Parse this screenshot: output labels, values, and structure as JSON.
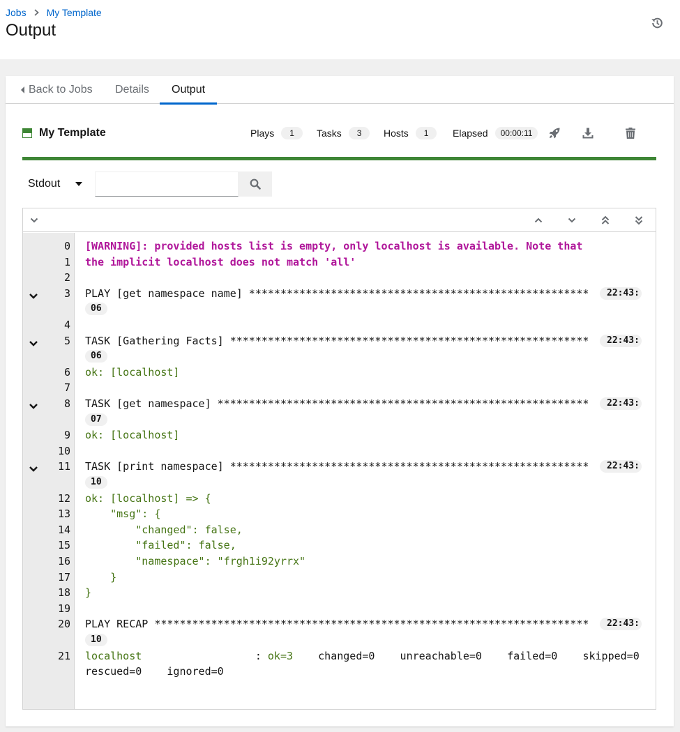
{
  "breadcrumb": {
    "jobs": "Jobs",
    "template": "My Template"
  },
  "page": {
    "title": "Output"
  },
  "tabs": {
    "back": "Back to Jobs",
    "details": "Details",
    "output": "Output"
  },
  "job": {
    "name": "My Template",
    "status": "successful",
    "plays_label": "Plays",
    "plays": "1",
    "tasks_label": "Tasks",
    "tasks": "3",
    "hosts_label": "Hosts",
    "hosts": "1",
    "elapsed_label": "Elapsed",
    "elapsed": "00:00:11"
  },
  "colors": {
    "success": "#3e8635",
    "link": "#0066cc",
    "warning": "#b0169a",
    "ok": "#467515"
  },
  "search": {
    "type": "Stdout",
    "value": ""
  },
  "output": [
    {
      "n": "0",
      "text": "[WARNING]: provided hosts list is empty, only localhost is available. Note that",
      "style": "warn"
    },
    {
      "n": "1",
      "text": "the implicit localhost does not match 'all'",
      "style": "warn"
    },
    {
      "n": "2",
      "text": ""
    },
    {
      "n": "3",
      "text": "PLAY [get namespace name] ******************************************************",
      "time": "22:43:",
      "time2": "06",
      "collapsible": true
    },
    {
      "n": "4",
      "text": ""
    },
    {
      "n": "5",
      "text": "TASK [Gathering Facts] *********************************************************",
      "time": "22:43:",
      "time2": "06",
      "collapsible": true
    },
    {
      "n": "6",
      "text": "ok: [localhost]",
      "style": "ok"
    },
    {
      "n": "7",
      "text": ""
    },
    {
      "n": "8",
      "text": "TASK [get namespace] ***********************************************************",
      "time": "22:43:",
      "time2": "07",
      "collapsible": true
    },
    {
      "n": "9",
      "text": "ok: [localhost]",
      "style": "ok"
    },
    {
      "n": "10",
      "text": ""
    },
    {
      "n": "11",
      "text": "TASK [print namespace] *********************************************************",
      "time": "22:43:",
      "time2": "10",
      "collapsible": true
    },
    {
      "n": "12",
      "text": "ok: [localhost] => {",
      "style": "ok"
    },
    {
      "n": "13",
      "text": "    \"msg\": {",
      "style": "ok"
    },
    {
      "n": "14",
      "text": "        \"changed\": false,",
      "style": "ok"
    },
    {
      "n": "15",
      "text": "        \"failed\": false,",
      "style": "ok"
    },
    {
      "n": "16",
      "text": "        \"namespace\": \"frgh1i92yrrx\"",
      "style": "ok"
    },
    {
      "n": "17",
      "text": "    }",
      "style": "ok"
    },
    {
      "n": "18",
      "text": "}",
      "style": "ok"
    },
    {
      "n": "19",
      "text": ""
    },
    {
      "n": "20",
      "text": "PLAY RECAP *********************************************************************",
      "time": "22:43:",
      "time2": "10"
    },
    {
      "n": "21",
      "recap": {
        "host": "localhost",
        "sep": "                  : ",
        "ok": "ok=3",
        "rest": "    changed=0    unreachable=0    failed=0    skipped=0",
        "wrap": "rescued=0    ignored=0"
      }
    }
  ]
}
